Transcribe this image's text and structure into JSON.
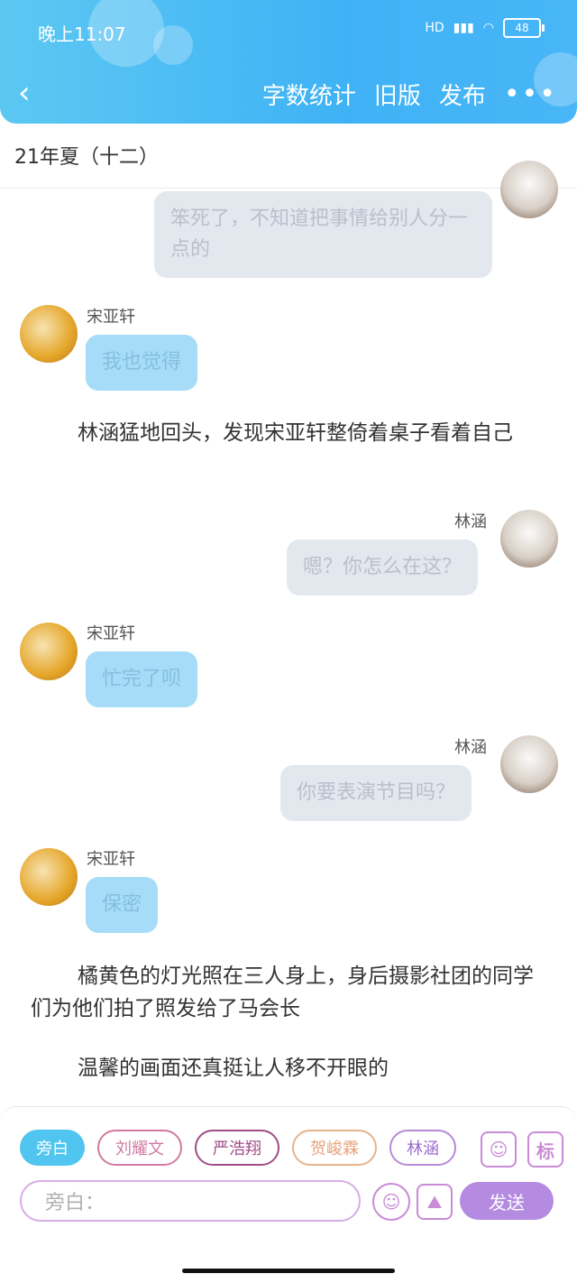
{
  "status_bar": {
    "time": "晚上11:07",
    "battery": "48",
    "net_label": "HD"
  },
  "header": {
    "back_icon": "back-icon",
    "actions": [
      "字数统计",
      "旧版",
      "发布"
    ],
    "more_icon": "more-dots-icon"
  },
  "chapter_title": "21年夏（十二）",
  "messages": [
    {
      "side": "right",
      "avatar": "dog-avatar",
      "text": "笨死了，不知道把事情给别人分一点的"
    },
    {
      "side": "left",
      "name": "宋亚轩",
      "avatar": "person-avatar",
      "text": "我也觉得"
    },
    {
      "type": "narration",
      "text": "林涵猛地回头，发现宋亚轩整倚着桌子看着自己"
    },
    {
      "side": "right",
      "name": "林涵",
      "avatar": "dog-avatar",
      "text": "嗯？你怎么在这？"
    },
    {
      "side": "left",
      "name": "宋亚轩",
      "avatar": "person-avatar",
      "text": "忙完了呗"
    },
    {
      "side": "right",
      "name": "林涵",
      "avatar": "dog-avatar",
      "text": "你要表演节目吗？"
    },
    {
      "side": "left",
      "name": "宋亚轩",
      "avatar": "person-avatar",
      "text": "保密"
    },
    {
      "type": "narration",
      "text": "橘黄色的灯光照在三人身上，身后摄影社团的同学们为他们拍了照发给了马会长"
    },
    {
      "type": "narration",
      "text": "温馨的画面还真挺让人移不开眼的"
    }
  ],
  "role_chips": [
    "旁白",
    "刘耀文",
    "严浩翔",
    "贺峻霖",
    "林涵"
  ],
  "toolbar_icons": {
    "profile": "contact-card-icon",
    "tag": "标"
  },
  "composer": {
    "placeholder": "旁白：",
    "emoji_icon": "emoji-icon",
    "image_icon": "image-icon",
    "send_label": "发送"
  },
  "colors": {
    "header_blue": "#3fb2f5",
    "send_purple": "#b48be1",
    "active_chip": "#4fc5ef"
  }
}
